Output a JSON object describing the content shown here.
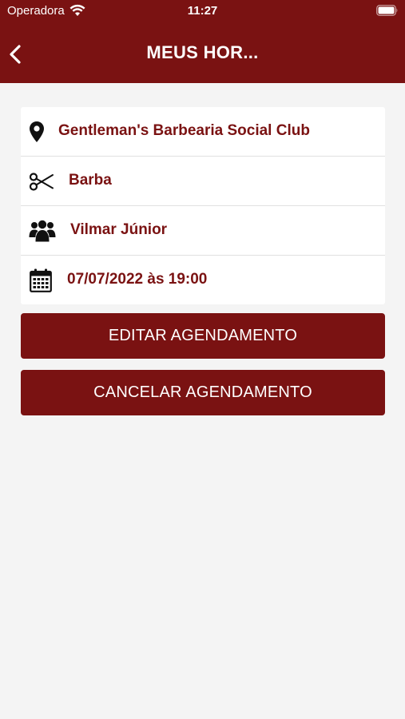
{
  "status_bar": {
    "carrier": "Operadora",
    "time": "11:27"
  },
  "header": {
    "title": "MEUS HOR...",
    "background_color": "#7a1212"
  },
  "appointment": {
    "location": {
      "icon": "map-pin-icon",
      "text": "Gentleman's Barbearia Social Club"
    },
    "service": {
      "icon": "scissors-icon",
      "text": "Barba"
    },
    "professional": {
      "icon": "people-icon",
      "text": "Vilmar Júnior"
    },
    "datetime": {
      "icon": "calendar-icon",
      "text": "07/07/2022 às 19:00"
    }
  },
  "actions": {
    "edit_label": "EDITAR AGENDAMENTO",
    "cancel_label": "CANCELAR AGENDAMENTO"
  },
  "colors": {
    "accent": "#7a1212",
    "background": "#f4f4f4",
    "card": "#ffffff"
  }
}
